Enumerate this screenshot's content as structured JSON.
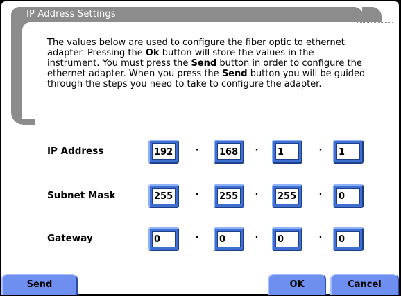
{
  "dialog": {
    "title": "IP Address Settings",
    "description_parts": [
      "The values below are used to configure the fiber optic to ethernet adapter.  Pressing the ",
      "Ok",
      " button will store the values in the instrument.  You must press the ",
      "Send",
      " button in order to configure the ethernet adapter.  When you press the ",
      "Send",
      " button you will be guided through the steps you need to take to configure the adapter."
    ]
  },
  "fields": [
    {
      "label": "IP Address",
      "octets": [
        "192",
        "168",
        "1",
        "1"
      ]
    },
    {
      "label": "Subnet Mask",
      "octets": [
        "255",
        "255",
        "255",
        "0"
      ]
    },
    {
      "label": "Gateway",
      "octets": [
        "0",
        "0",
        "0",
        "0"
      ]
    }
  ],
  "separator": "·",
  "buttons": {
    "send": "Send",
    "ok": "OK",
    "cancel": "Cancel"
  },
  "colors": {
    "frame": "#8c8c8c",
    "button": "#6f8ff0",
    "octet_border": "#3f6fd1"
  }
}
